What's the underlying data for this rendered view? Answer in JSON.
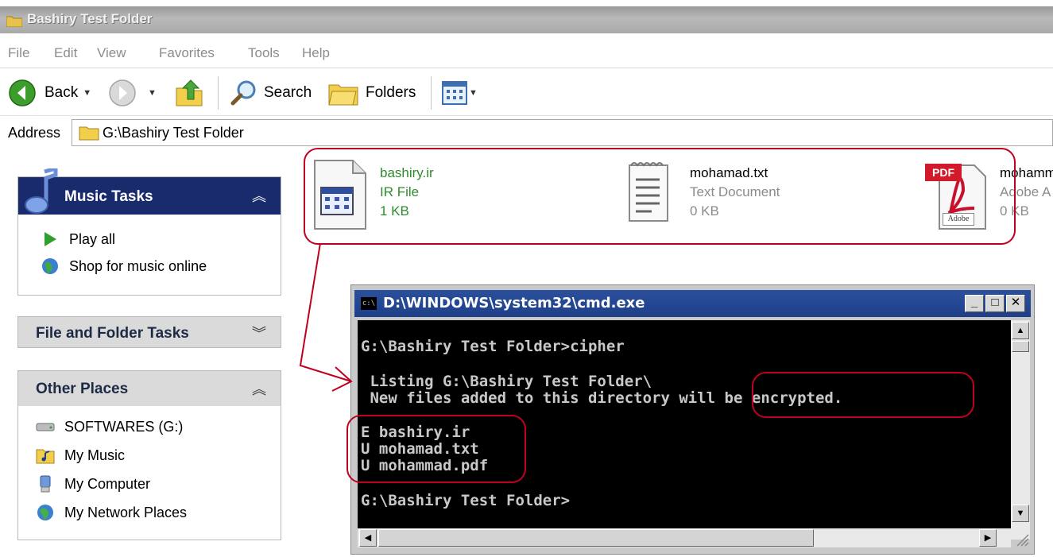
{
  "window": {
    "title": "Bashiry Test Folder"
  },
  "menu": {
    "items": [
      "File",
      "Edit",
      "View",
      "Favorites",
      "Tools",
      "Help"
    ]
  },
  "toolbar": {
    "back_label": "Back",
    "search_label": "Search",
    "folders_label": "Folders"
  },
  "address": {
    "label": "Address",
    "path": "G:\\Bashiry Test Folder"
  },
  "tasks": {
    "music": {
      "title": "Music Tasks",
      "items": [
        "Play all",
        "Shop for music online"
      ]
    },
    "file_folder": {
      "title": "File and Folder Tasks"
    },
    "other_places": {
      "title": "Other Places",
      "items": [
        "SOFTWARES (G:)",
        "My Music",
        "My Computer",
        "My Network Places"
      ]
    }
  },
  "files": [
    {
      "name": "bashiry.ir",
      "type": "IR File",
      "size": "1 KB"
    },
    {
      "name": "mohamad.txt",
      "type": "Text Document",
      "size": "0 KB"
    },
    {
      "name": "mohamm",
      "type": "Adobe A",
      "size": "0 KB",
      "badge": "PDF",
      "brand": "Adobe"
    }
  ],
  "cmd": {
    "title": "D:\\WINDOWS\\system32\\cmd.exe",
    "icon_text": "c:\\",
    "lines": [
      "G:\\Bashiry Test Folder>cipher",
      " Listing G:\\Bashiry Test Folder\\",
      " New files added to this directory will be encrypted.",
      "E bashiry.ir",
      "U mohamad.txt",
      "U mohammad.pdf",
      "G:\\Bashiry Test Folder>"
    ]
  },
  "colors": {
    "annotation": "#c00020",
    "task_header": "#192b6c",
    "console_bg": "#000000",
    "console_text": "#c8c8c8"
  }
}
